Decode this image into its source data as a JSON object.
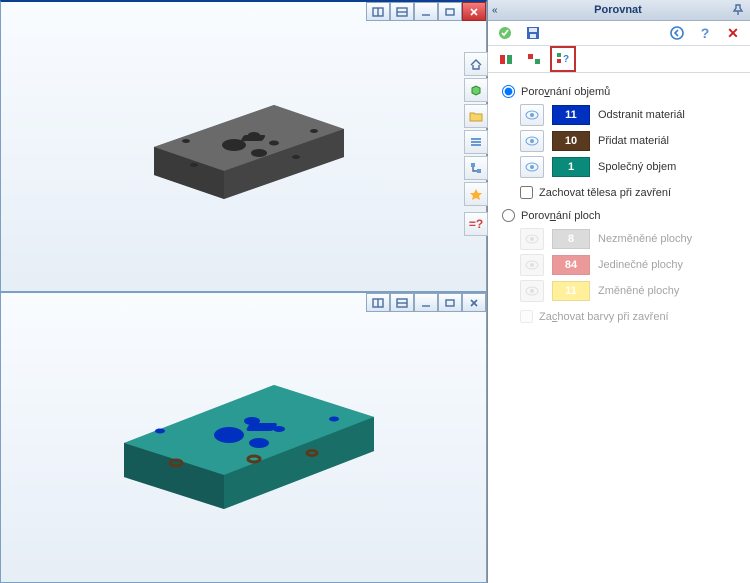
{
  "panel": {
    "title": "Porovnat",
    "group_volumes": {
      "label_pre": "Poro",
      "label_u": "v",
      "label_post": "nání objemů",
      "selected": true,
      "rows": [
        {
          "count": "11",
          "swatch": "sw-blue",
          "label": "Odstranit materiál"
        },
        {
          "count": "10",
          "swatch": "sw-brown",
          "label": "Přidat materiál"
        },
        {
          "count": "1",
          "swatch": "sw-teal",
          "label": "Společný objem"
        }
      ],
      "keep_label": "Zachovat tělesa při zavření"
    },
    "group_faces": {
      "label_pre": "Porov",
      "label_u": "n",
      "label_post": "ání ploch",
      "rows": [
        {
          "count": "8",
          "swatch": "sw-gray",
          "label": "Nezměněné plochy"
        },
        {
          "count": "84",
          "swatch": "sw-red",
          "label": "Jedinečné plochy"
        },
        {
          "count": "11",
          "swatch": "sw-yellow",
          "label": "Změněné plochy"
        }
      ],
      "keep_label_pre": "Za",
      "keep_label_u": "c",
      "keep_label_post": "hovat barvy při zavření"
    }
  }
}
